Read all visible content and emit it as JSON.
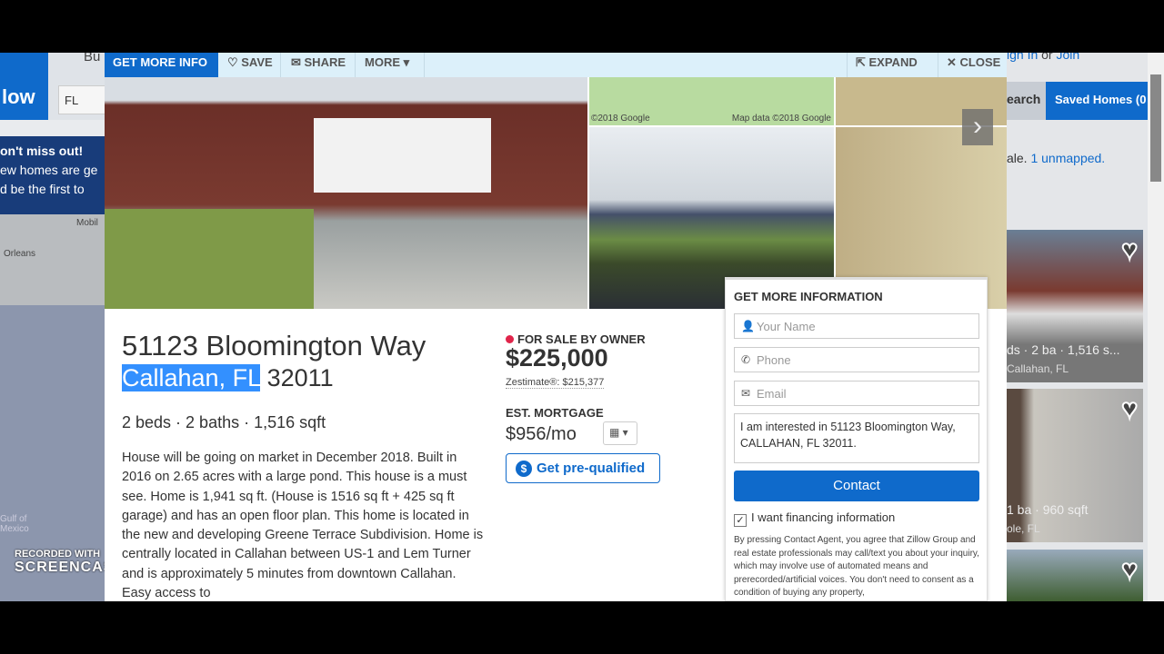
{
  "background": {
    "logo": "low",
    "nav_buy": "Bu",
    "search_value": "FL",
    "banner": [
      "on't miss out!",
      "ew homes are ge",
      "d be the first to"
    ],
    "map_labels": [
      "Mobil",
      "Orleans",
      "Gulf of Mexico"
    ],
    "signin": "ign In",
    "signin_or": "or",
    "join": "Join",
    "search_tab": "earch",
    "saved_homes_tab": "Saved Homes (0",
    "results_text": "ale.",
    "unmapped_link": "1 unmapped.",
    "cards": [
      {
        "facts": "ds · 2 ba · 1,516 s...",
        "location": "Callahan, FL"
      },
      {
        "facts": "1 ba · 960 sqft",
        "location": "ole, FL"
      },
      {
        "facts": "",
        "location": ""
      }
    ]
  },
  "watermark": {
    "line1": "RECORDED WITH",
    "line2": "SCREENCAST-O-MATIC"
  },
  "toolbar": {
    "get_more_info": "GET MORE INFO",
    "save": "♡ SAVE",
    "share": "✉ SHARE",
    "more": "MORE ▾",
    "expand": "⇱ EXPAND",
    "close": "✕ CLOSE"
  },
  "photos": {
    "map_attr_left": "©2018 Google",
    "map_attr_right": "Map data ©2018 Google",
    "next": "›"
  },
  "listing": {
    "street": "51123 Bloomington Way",
    "city_state": "Callahan, FL",
    "zip": "32011",
    "facts": "2 beds · 2 baths · 1,516 sqft",
    "description": "House will be going on market in December 2018. Built in 2016 on 2.65 acres with a large pond. This house is a must see. Home is 1,941 sq ft. (House is 1516 sq ft + 425 sq ft garage) and has an open floor plan. This home is located in the new and developing Greene Terrace Subdivision.  Home is centrally located in Callahan between US-1 and Lem Turner and is approximately 5 minutes from downtown Callahan.  Easy access to",
    "status": "FOR SALE BY OWNER",
    "status_color": "#e0244a",
    "price": "$225,000",
    "zestimate": "Zestimate®: $215,377",
    "mortgage_label": "EST. MORTGAGE",
    "mortgage": "$956/mo",
    "calc": "▦ ▾",
    "prequal_icon": "$",
    "prequal": "Get pre-qualified"
  },
  "form": {
    "title": "GET MORE INFORMATION",
    "name_placeholder": "Your Name",
    "phone_placeholder": "Phone",
    "email_placeholder": "Email",
    "message": "I am interested in 51123 Bloomington Way, CALLAHAN, FL 32011.",
    "contact": "Contact",
    "financing_label": "I want financing information",
    "financing_checked": true,
    "legal": "By pressing Contact Agent, you agree that Zillow Group and real estate professionals may call/text you about your inquiry, which may involve use of automated means and prerecorded/artificial voices. You don't need to consent as a condition of buying any property,"
  },
  "colors": {
    "brand": "#0f6acb",
    "toolbar_bg": "#dcf0fa"
  }
}
